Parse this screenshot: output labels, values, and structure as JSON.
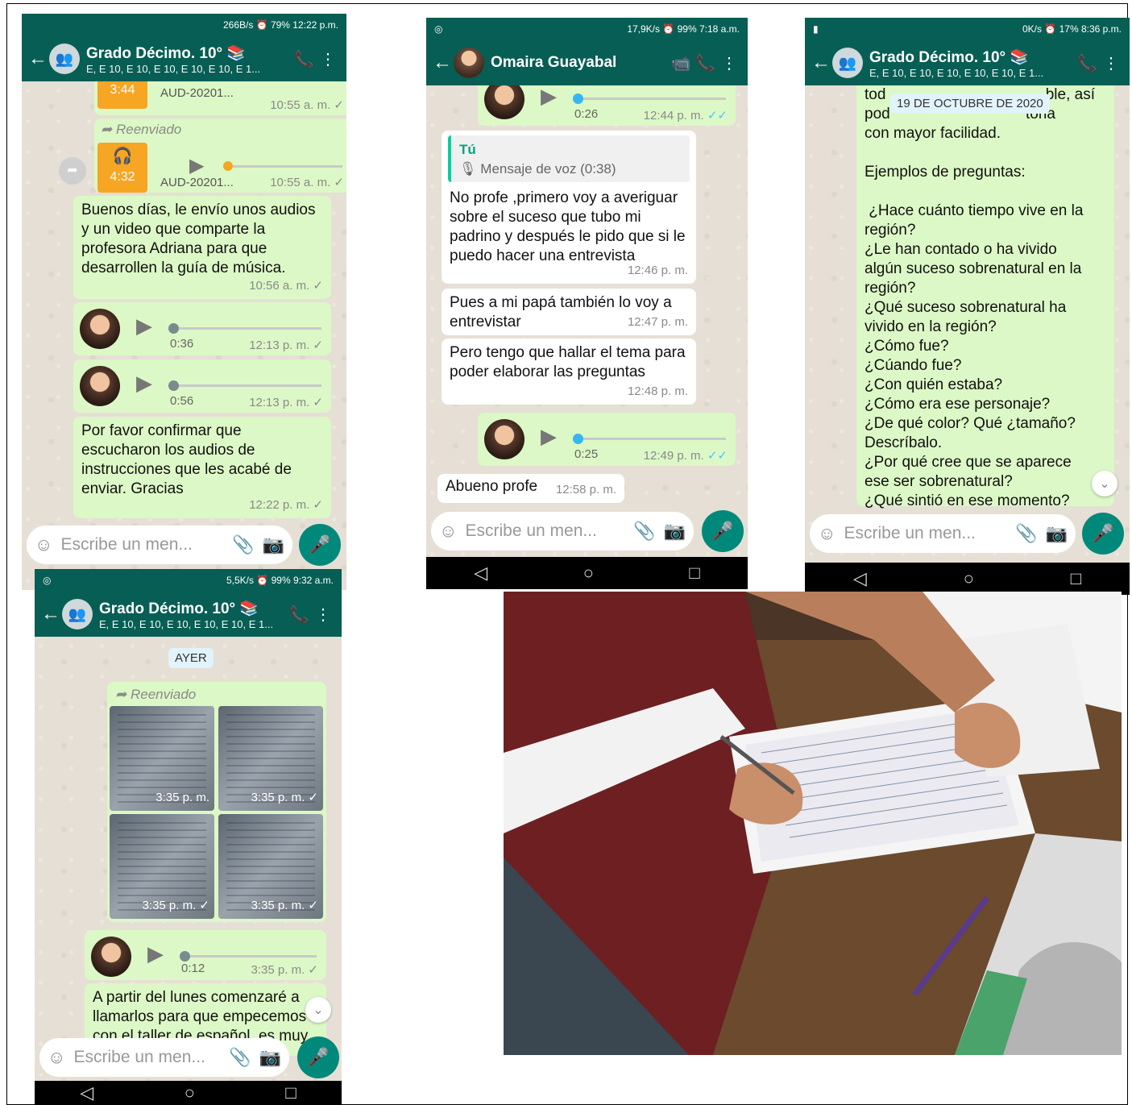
{
  "phone1": {
    "status": {
      "text": "266B/s ⏰ 79% 12:22 p.m."
    },
    "header": {
      "title": "Grado Décimo. 10° 📚",
      "subtitle": "E, E 10, E 10, E 10, E 10, E 10, E 1..."
    },
    "audio1": {
      "duration": "3:44",
      "name": "AUD-20201...",
      "time": "10:55 a. m."
    },
    "audio2": {
      "forwarded": "Reenviado",
      "duration": "4:32",
      "name": "AUD-20201...",
      "time": "10:55 a. m."
    },
    "msg1": {
      "text": "Buenos días, le envío unos audios y un video que comparte la profesora Adriana para que desarrollen la guía de música.",
      "time": "10:56 a. m."
    },
    "voice1": {
      "duration": "0:36",
      "time": "12:13 p. m."
    },
    "voice2": {
      "duration": "0:56",
      "time": "12:13 p. m."
    },
    "msg2": {
      "text": "Por favor confirmar que escucharon los audios de instrucciones que les acabé de enviar. Gracias",
      "time": "12:22 p. m."
    },
    "input": {
      "placeholder": "Escribe un men..."
    }
  },
  "phone2": {
    "status": {
      "text": "17,9K/s ⏰ 99% 7:18 a.m."
    },
    "header": {
      "title": "Omaira Guayabal"
    },
    "voice_top": {
      "duration": "0:26",
      "time": "12:44 p. m."
    },
    "reply": {
      "who": "Tú",
      "what": "🎙 Mensaje de voz (0:38)"
    },
    "msg1": {
      "text": "No profe ,primero voy a averiguar sobre el suceso que tubo mi padrino y después le pido  que si le puedo hacer una entrevista",
      "time": "12:46 p. m."
    },
    "msg2": {
      "text": "Pues a mi papá también lo voy a entrevistar",
      "time": "12:47 p. m."
    },
    "msg3": {
      "text": "Pero tengo que hallar el tema para poder elaborar las preguntas",
      "time": "12:48 p. m."
    },
    "voice2": {
      "duration": "0:25",
      "time": "12:49 p. m."
    },
    "msg4": {
      "text": "Abueno profe",
      "time": "12:58 p. m."
    },
    "input": {
      "placeholder": "Escribe un men..."
    }
  },
  "phone3": {
    "status": {
      "text": "0K/s ⏰ 17% 8:36 p.m."
    },
    "header": {
      "title": "Grado Décimo. 10° 📚",
      "subtitle": "E, E 10, E 10, E 10, E 10, E 10, E 1..."
    },
    "date_pill": "19 DE OCTUBRE DE 2020",
    "msg_top": "todos le, así podemos construir la historia con mayor facilidad.",
    "lines": [
      "con mayor facilidad.",
      "",
      "Ejemplos de preguntas:",
      "",
      " ¿Hace cuánto tiempo vive en la",
      "región?",
      "¿Le han contado o ha vivido",
      "algún suceso sobrenatural en la",
      "región?",
      "¿Qué suceso sobrenatural ha",
      "vivido en la región?",
      "¿Cómo fue?",
      "¿Cúando fue?",
      "¿Con quién estaba?",
      "¿Cómo era ese personaje?",
      "¿De qué color? Qué ¿tamaño?",
      "Descríbalo.",
      "¿Por qué cree que se aparece",
      "ese ser sobrenatural?",
      "¿Qué sintió en ese momento?"
    ],
    "top_partial_1": "tod",
    "top_partial_2": "ble, así",
    "top_partial_3": "pod",
    "top_partial_4": "toria",
    "input": {
      "placeholder": "Escribe un men..."
    }
  },
  "phone4": {
    "status": {
      "text": "5,5K/s ⏰ 99% 9:32 a.m."
    },
    "header": {
      "title": "Grado Décimo. 10° 📚",
      "subtitle": "E, E 10, E 10, E 10, E 10, E 10, E 1..."
    },
    "day_pill": "AYER",
    "forwarded": "Reenviado",
    "photos": [
      {
        "time": "3:35 p. m."
      },
      {
        "time": "3:35 p. m. ✓"
      },
      {
        "time": "3:35 p. m. ✓"
      },
      {
        "time": "3:35 p. m. ✓"
      }
    ],
    "voice": {
      "duration": "0:12",
      "time": "3:35 p. m."
    },
    "msg": {
      "text": "A partir del lunes comenzaré a llamarlos para que empecemos con el taller de español, es muy"
    },
    "input": {
      "placeholder": "Escribe un men..."
    }
  },
  "photo": {
    "desc_label": ""
  },
  "colors": {
    "header": "#075e54",
    "out_bubble": "#dcf8c6",
    "mic": "#00897b",
    "orange": "#f6a623"
  }
}
